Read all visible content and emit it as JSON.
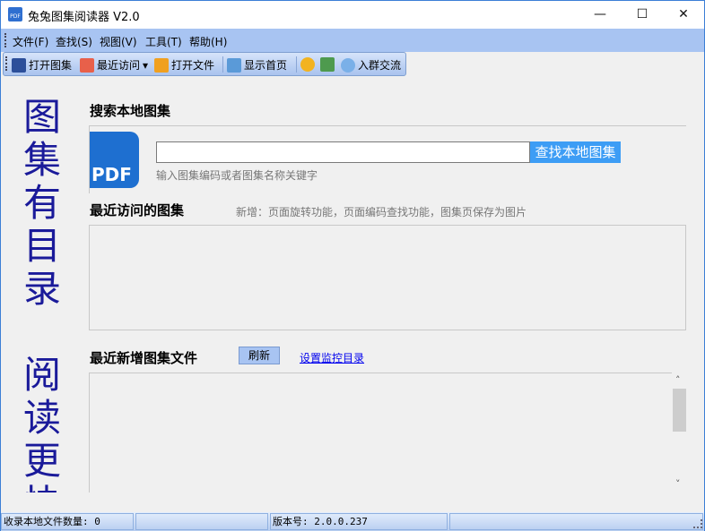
{
  "window": {
    "title": "兔兔图集阅读器 V2.0",
    "minimize": "—",
    "maximize": "☐",
    "close": "✕"
  },
  "menu": [
    "文件(F)",
    "查找(S)",
    "视图(V)",
    "工具(T)",
    "帮助(H)"
  ],
  "toolbar": {
    "open_album": "打开图集",
    "recent": "最近访问",
    "recent_arrow": "▾",
    "open_file": "打开文件",
    "home": "显示首页",
    "join_group": "入群交流"
  },
  "side_text": {
    "top": [
      "图",
      "集",
      "有",
      "目",
      "录"
    ],
    "bottom": [
      "阅",
      "读",
      "更",
      "快"
    ]
  },
  "search": {
    "heading": "搜索本地图集",
    "button": "查找本地图集",
    "hint": "输入图集编码或者图集名称关键字",
    "value": "",
    "logo": "PDF"
  },
  "recent": {
    "heading": "最近访问的图集",
    "notice": "新增：页面旋转功能，页面编码查找功能，图集页保存为图片"
  },
  "new_files": {
    "heading": "最近新增图集文件",
    "refresh": "刷新",
    "monitor_link": "设置监控目录",
    "scroll_up": "˄",
    "scroll_down": "˅"
  },
  "status": {
    "count": "收录本地文件数量: 0",
    "version": "版本号: 2.0.0.237"
  },
  "colors": {
    "menubar": "#a8c4f2",
    "search_button": "#3d9df5",
    "side_text": "#1a1a9a",
    "link": "#0000ee"
  }
}
